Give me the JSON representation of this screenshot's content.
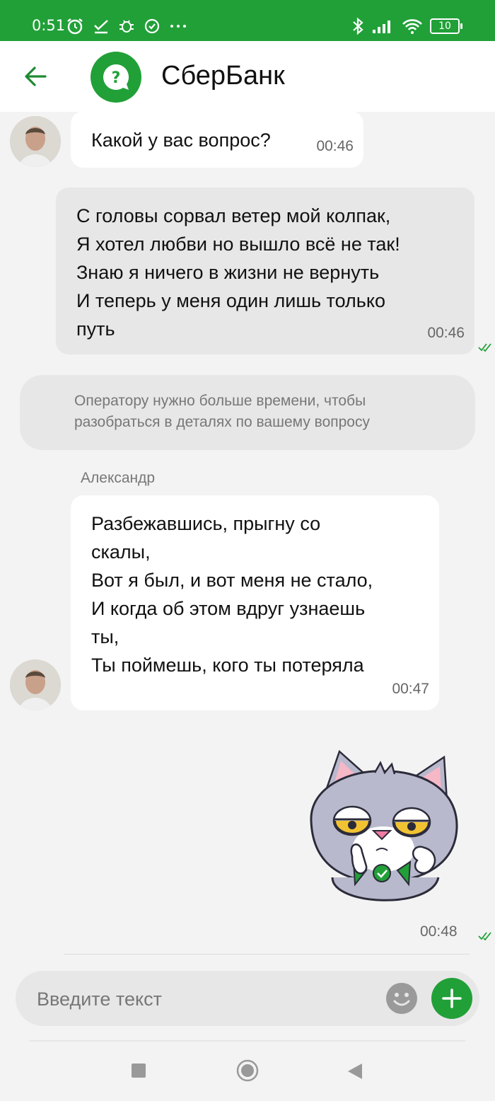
{
  "status_bar": {
    "time": "0:51",
    "battery": "10",
    "icons_left": [
      "alarm-icon",
      "checkmark-icon",
      "bug-icon",
      "circle-check-icon",
      "more-icon"
    ],
    "icons_right": [
      "bluetooth-icon",
      "signal-icon",
      "wifi-icon",
      "battery-icon"
    ]
  },
  "header": {
    "title": "СберБанк",
    "back_icon": "back-arrow-icon",
    "logo_icon": "question-bubble-icon"
  },
  "messages": [
    {
      "direction": "in",
      "text": "Какой у вас вопрос?",
      "time": "00:46"
    },
    {
      "direction": "out",
      "text_lines": [
        "С головы сорвал ветер мой колпак,",
        "Я хотел любви но вышло всё не так!",
        "Знаю я ничего в жизни не вернуть",
        "И теперь у меня один лишь только",
        "путь"
      ],
      "time": "00:46",
      "status": "read"
    },
    {
      "direction": "system",
      "text_lines": [
        "Оператору нужно больше времени, чтобы",
        "разобраться в деталях по вашему вопросу"
      ]
    },
    {
      "direction": "in",
      "sender": "Александр",
      "text_lines": [
        "Разбежавшись, прыгну со",
        "скалы,",
        "Вот я был, и вот меня не стало,",
        "И когда об этом вдруг узнаешь",
        "ты,",
        "Ты поймешь, кого ты потеряла"
      ],
      "time": "00:47"
    },
    {
      "direction": "out",
      "type": "sticker",
      "sticker": "grey-cat-ok-gesture-sticker",
      "time": "00:48",
      "status": "read"
    }
  ],
  "composer": {
    "placeholder": "Введите текст",
    "emoji_icon": "emoji-icon",
    "add_icon": "plus-icon"
  },
  "colors": {
    "brand": "#21a038",
    "chat_bg": "#f3f3f3",
    "incoming_bubble": "#ffffff",
    "outgoing_bubble": "#e7e7e7"
  },
  "nav": [
    "recents-icon",
    "home-icon",
    "back-icon"
  ]
}
